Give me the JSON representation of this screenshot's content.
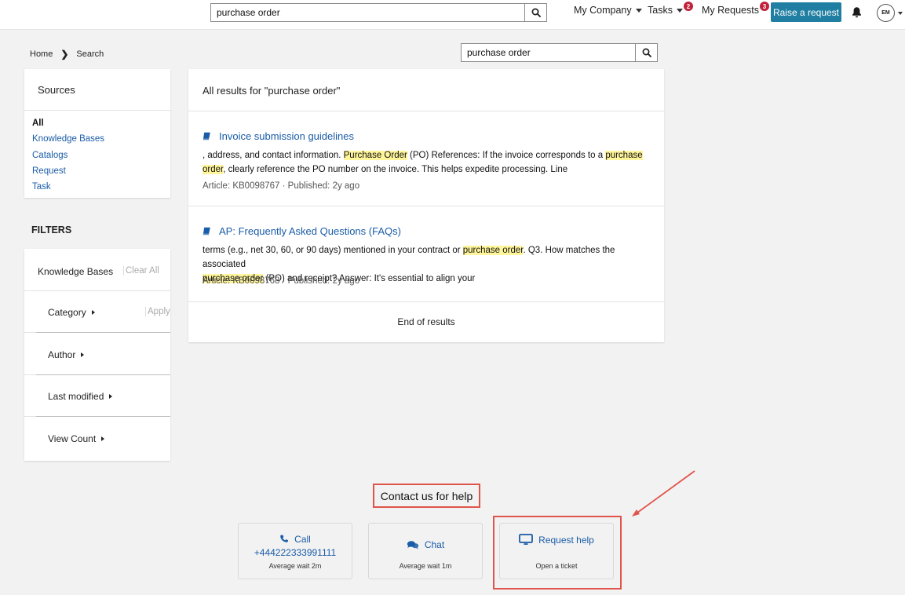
{
  "header": {
    "search_value": "purchase order",
    "company_label": "My Company",
    "tasks_label": "Tasks",
    "tasks_badge": "2",
    "requests_label": "My Requests",
    "requests_badge": "3",
    "raise_label": "Raise a request",
    "avatar_initials": "EM"
  },
  "breadcrumb": {
    "home": "Home",
    "current": "Search"
  },
  "search": {
    "value": "purchase order"
  },
  "sources": {
    "title": "Sources",
    "items": [
      "All",
      "Knowledge Bases",
      "Catalogs",
      "Request",
      "Task"
    ]
  },
  "filters": {
    "title": "FILTERS",
    "group_label": "Knowledge Bases",
    "clear_all": "Clear All",
    "apply": "Apply",
    "rows": [
      "Category",
      "Author",
      "Last modified",
      "View Count"
    ]
  },
  "results": {
    "heading": "All results for \"purchase order\"",
    "items": [
      {
        "title": "Invoice submission guidelines",
        "s1": ", address, and contact information. ",
        "h1": "Purchase Order",
        "s2": " (PO) References: If the invoice corresponds to a ",
        "h2": "purchase",
        "h3": "order",
        "s3": ", clearly reference the PO number on the invoice. This helps expedite processing. Line",
        "meta": "Article: KB0098767  ·  Published: 2y ago"
      },
      {
        "title": "AP: Frequently Asked Questions (FAQs)",
        "s1": "terms (e.g., net 30, 60, or 90 days) mentioned in your contract or ",
        "h1": "purchase order",
        "s2": ". Q3. How matches the associated ",
        "h2": "purchase order",
        "s3": " (PO) and receipt? Answer: It's essential to align your",
        "meta": "Article: KB0098768  ·  Published: 2y ago"
      }
    ],
    "end_text": "End of results"
  },
  "contact": {
    "title": "Contact us for help",
    "call": {
      "label": "Call",
      "phone": "+444222333991111",
      "sub": "Average wait 2m"
    },
    "chat": {
      "label": "Chat",
      "sub": "Average wait 1m"
    },
    "request": {
      "label": "Request help",
      "sub": "Open a ticket"
    }
  },
  "colors": {
    "link": "#1a5ca7",
    "primary_button": "#1f7ea1",
    "badge": "#c2213a",
    "highlight": "#fff59a",
    "annotation": "#e0554b"
  },
  "icons": [
    "search-icon",
    "bell-icon",
    "chevron-right-icon",
    "book-icon",
    "phone-icon",
    "chat-icon",
    "monitor-icon"
  ]
}
